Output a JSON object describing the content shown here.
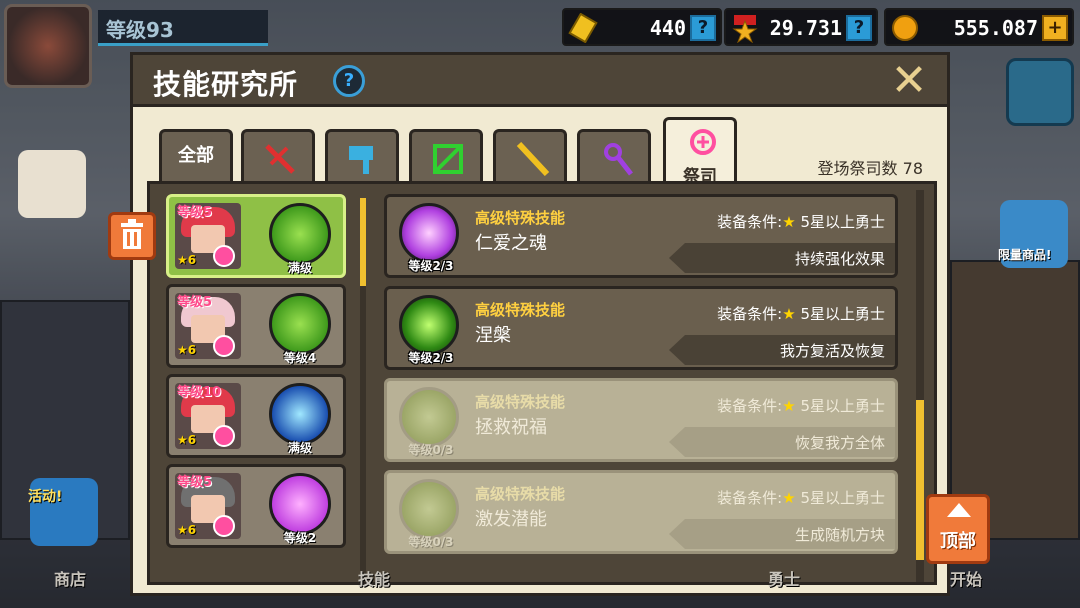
{
  "header": {
    "level_label": "等级93",
    "currencies": [
      {
        "name": "ticket",
        "icon": "ticket-icon",
        "value": "440",
        "button": "?"
      },
      {
        "name": "medal",
        "icon": "medal-icon",
        "value": "29.731",
        "button": "?"
      },
      {
        "name": "gold",
        "icon": "coin-icon",
        "value": "555.087",
        "button": "+"
      }
    ]
  },
  "panel": {
    "title": "技能研究所",
    "help": "?",
    "tabs": [
      {
        "label": "全部",
        "icon": "all-icon",
        "active": false
      },
      {
        "label": "",
        "icon": "sword-icon",
        "active": false
      },
      {
        "label": "",
        "icon": "hammer-icon",
        "active": false
      },
      {
        "label": "",
        "icon": "bow-icon",
        "active": false
      },
      {
        "label": "",
        "icon": "gun-icon",
        "active": false
      },
      {
        "label": "",
        "icon": "staff-icon",
        "active": false
      },
      {
        "label": "祭司",
        "icon": "priest-icon",
        "active": true
      }
    ],
    "priest_count": "登场祭司数 78"
  },
  "heroes": [
    {
      "level": "等级5",
      "star": "6",
      "orb_label": "满级",
      "selected": true,
      "orb_color": "#3f9a1c",
      "hair": "#e03a4a"
    },
    {
      "level": "等级5",
      "star": "6",
      "orb_label": "等级4",
      "selected": false,
      "orb_color": "#3f9a1c",
      "hair": "#f0c8d0"
    },
    {
      "level": "等级10",
      "star": "6",
      "orb_label": "满级",
      "selected": false,
      "orb_color": "#1a4fb0",
      "hair": "#e03a4a"
    },
    {
      "level": "等级5",
      "star": "6",
      "orb_label": "等级2",
      "selected": false,
      "orb_color": "#c040e0",
      "hair": "#707070"
    }
  ],
  "skills": [
    {
      "category": "高级特殊技能",
      "name": "仁爱之魂",
      "level": "等级2/3",
      "req_label": "装备条件:",
      "req_value": "5星以上勇士",
      "effect": "持续强化效果",
      "locked": false,
      "icon": "heart-soul-icon",
      "color": "#b040e0"
    },
    {
      "category": "高级特殊技能",
      "name": "涅槃",
      "level": "等级2/3",
      "req_label": "装备条件:",
      "req_value": "5星以上勇士",
      "effect": "我方复活及恢复",
      "locked": false,
      "icon": "nirvana-icon",
      "color": "#2f8a14"
    },
    {
      "category": "高级特殊技能",
      "name": "拯救祝福",
      "level": "等级0/3",
      "req_label": "装备条件:",
      "req_value": "5星以上勇士",
      "effect": "恢复我方全体",
      "locked": true,
      "icon": "blessing-icon",
      "color": "#7a9a30"
    },
    {
      "category": "高级特殊技能",
      "name": "激发潜能",
      "level": "等级0/3",
      "req_label": "装备条件:",
      "req_value": "5星以上勇士",
      "effect": "生成随机方块",
      "locked": true,
      "icon": "potential-icon",
      "color": "#7a9a30"
    }
  ],
  "buttons": {
    "top": "顶部"
  },
  "bottom_nav": [
    "商店",
    "技能",
    "勇士",
    "开始"
  ],
  "side": {
    "event_label": "活动!",
    "limited_label": "限量商品!"
  }
}
